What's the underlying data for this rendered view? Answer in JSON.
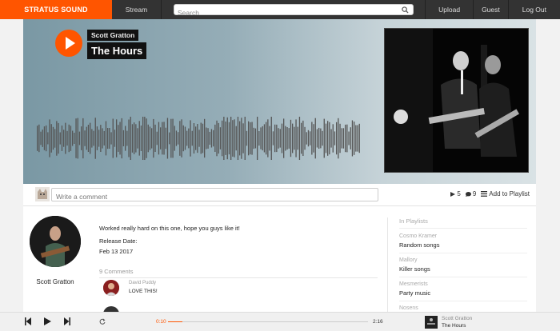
{
  "nav": {
    "brand": "STRATUS SOUND",
    "stream": "Stream",
    "search_placeholder": "Search",
    "upload": "Upload",
    "guest": "Guest",
    "logout": "Log Out"
  },
  "track": {
    "artist": "Scott Gratton",
    "title": "The Hours"
  },
  "comment_bar": {
    "placeholder": "Write a comment",
    "plays": "5",
    "comments": "9",
    "add_to_playlist": "Add to Playlist"
  },
  "profile": {
    "name": "Scott Gratton"
  },
  "details": {
    "description": "Worked really hard on this one, hope you guys like it!",
    "release_label": "Release Date:",
    "release_date": "Feb 13 2017",
    "comments_count": "9 Comments"
  },
  "comments": [
    {
      "user": "David Puddy",
      "text": "LOVE THIS!"
    }
  ],
  "playlists": {
    "heading": "In Playlists",
    "items": [
      {
        "user": "Cosmo Kramer",
        "name": "Random songs"
      },
      {
        "user": "Mallory",
        "name": "Killer songs"
      },
      {
        "user": "Mesmerists",
        "name": "Party music"
      },
      {
        "user": "Nosens",
        "name": ""
      }
    ]
  },
  "player": {
    "current_time": "0:10",
    "total_time": "2:16",
    "progress": 0.07,
    "artist": "Scott Gratton",
    "title": "The Hours"
  },
  "colors": {
    "accent": "#ff5500",
    "nav_bg": "#333333"
  }
}
